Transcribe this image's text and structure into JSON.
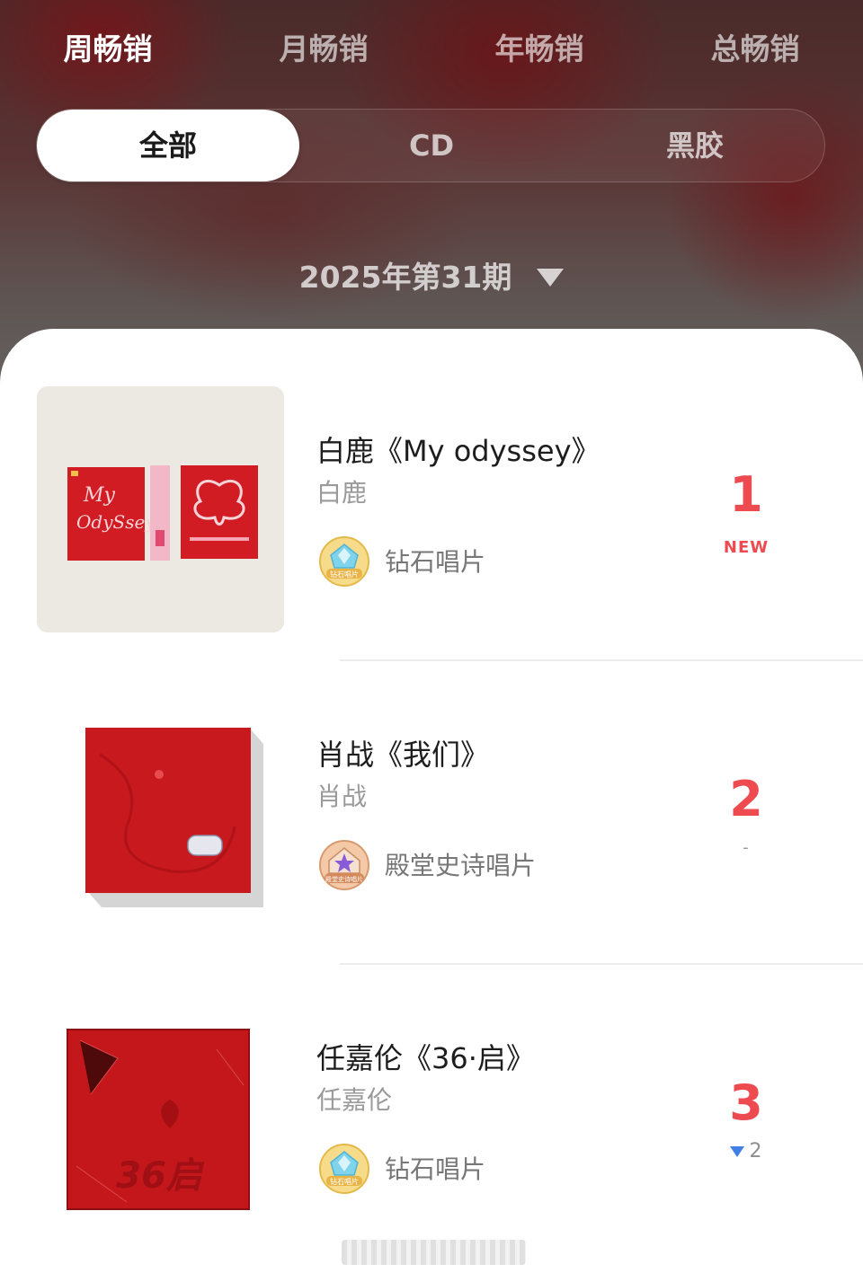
{
  "top_tabs": [
    {
      "label": "周畅销",
      "active": true
    },
    {
      "label": "月畅销",
      "active": false
    },
    {
      "label": "年畅销",
      "active": false
    },
    {
      "label": "总畅销",
      "active": false
    }
  ],
  "segments": [
    {
      "label": "全部",
      "active": true
    },
    {
      "label": "CD",
      "active": false
    },
    {
      "label": "黑胶",
      "active": false
    }
  ],
  "period": {
    "label": "2025年第31期",
    "icon": "caret-down-icon"
  },
  "colors": {
    "accent": "#ee4b51",
    "down_arrow": "#3f7fe6",
    "album_red": "#c8191e"
  },
  "chart": [
    {
      "title": "白鹿《My odyssey》",
      "artist": "白鹿",
      "badge": {
        "label": "钻石唱片",
        "icon": "diamond-record-badge-icon",
        "icon_text": "钻石唱片"
      },
      "rank": "1",
      "change": "NEW",
      "change_type": "new",
      "cover": {
        "icon": "my-odyssey-album-cover-icon"
      }
    },
    {
      "title": "肖战《我们》",
      "artist": "肖战",
      "badge": {
        "label": "殿堂史诗唱片",
        "icon": "hall-epic-record-badge-icon",
        "icon_text": "殿堂史诗唱片"
      },
      "rank": "2",
      "change": "-",
      "change_type": "same",
      "cover": {
        "icon": "women-album-cover-icon"
      }
    },
    {
      "title": "任嘉伦《36·启》",
      "artist": "任嘉伦",
      "badge": {
        "label": "钻石唱片",
        "icon": "diamond-record-badge-icon",
        "icon_text": "钻石唱片"
      },
      "rank": "3",
      "change": "2",
      "change_type": "down",
      "cover": {
        "icon": "36-qi-album-cover-icon",
        "logo_text": "36启"
      }
    }
  ]
}
